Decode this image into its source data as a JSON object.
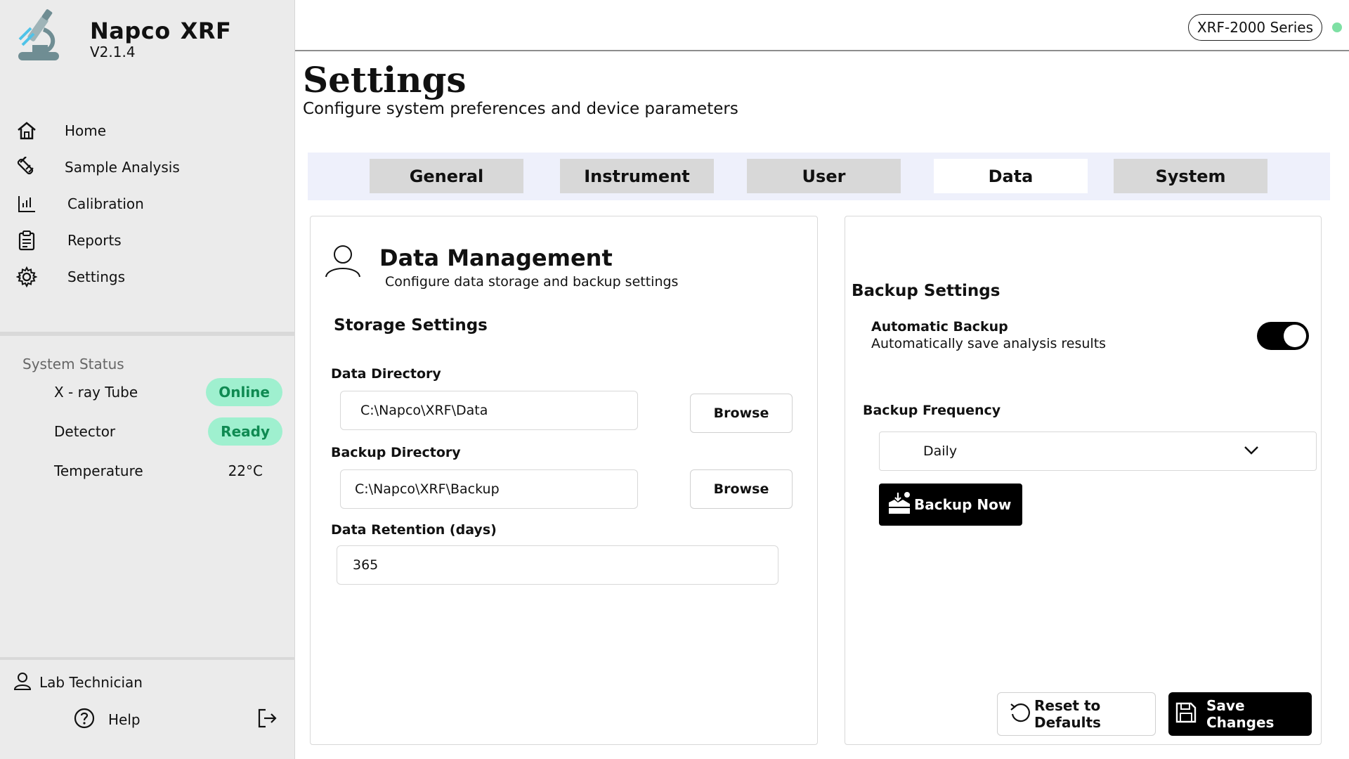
{
  "brand": {
    "name_1": "Napco",
    "name_2": "XRF",
    "version": "V2.1.4"
  },
  "nav": [
    {
      "label": "Home",
      "icon": "home-icon"
    },
    {
      "label": "Sample Analysis",
      "icon": "test-tube-icon"
    },
    {
      "label": "Calibration",
      "icon": "bar-chart-icon"
    },
    {
      "label": "Reports",
      "icon": "clipboard-icon"
    },
    {
      "label": "Settings",
      "icon": "gear-icon"
    }
  ],
  "status": {
    "title": "System Status",
    "xray_label": "X - ray Tube",
    "xray_value": "Online",
    "detector_label": "Detector",
    "detector_value": "Ready",
    "temp_label": "Temperature",
    "temp_value": "22°C",
    "badge_color": "#9ff0cf"
  },
  "user": {
    "name": "Lab Technician",
    "help": "Help"
  },
  "topbar": {
    "series": "XRF-2000 Series",
    "indicator_color": "#7ee0a4"
  },
  "page": {
    "title": "Settings",
    "subtitle": "Configure system preferences and device parameters"
  },
  "tabs": [
    {
      "label": "General"
    },
    {
      "label": "Instrument"
    },
    {
      "label": "User"
    },
    {
      "label": "Data",
      "active": true
    },
    {
      "label": "System"
    }
  ],
  "data_management": {
    "title": "Data Management",
    "subtitle": "Configure data storage and backup settings",
    "storage_title": "Storage Settings",
    "data_dir_label": "Data Directory",
    "data_dir_value": "C:\\Napco\\XRF\\Data",
    "backup_dir_label": "Backup Directory",
    "backup_dir_value": "C:\\Napco\\XRF\\Backup",
    "browse_label": "Browse",
    "retention_label": "Data Retention (days)",
    "retention_value": "365"
  },
  "backup": {
    "title": "Backup Settings",
    "auto_label": "Automatic Backup",
    "auto_desc": "Automatically save analysis results",
    "auto_enabled": true,
    "frequency_label": "Backup Frequency",
    "frequency_value": "Daily",
    "backup_now_label": "Backup Now"
  },
  "actions": {
    "reset_label": "Reset to Defaults",
    "save_label": "Save Changes"
  }
}
